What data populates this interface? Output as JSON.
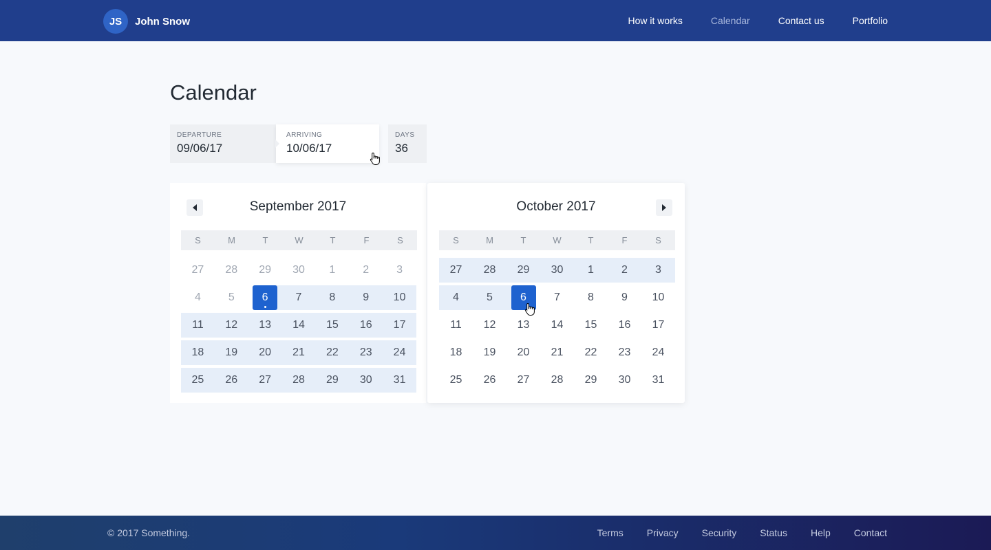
{
  "header": {
    "avatar_initials": "JS",
    "user_name": "John Snow",
    "nav": [
      {
        "label": "How it works",
        "active": false
      },
      {
        "label": "Calendar",
        "active": true
      },
      {
        "label": "Contact us",
        "active": false
      },
      {
        "label": "Portfolio",
        "active": false
      }
    ]
  },
  "page": {
    "title": "Calendar"
  },
  "fields": {
    "departure": {
      "label": "DEPARTURE",
      "value": "09/06/17"
    },
    "arriving": {
      "label": "ARRIVING",
      "value": "10/06/17"
    },
    "days": {
      "label": "DAYS",
      "value": "36"
    }
  },
  "calendars": [
    {
      "title": "September 2017",
      "weekdays": [
        "S",
        "M",
        "T",
        "W",
        "T",
        "F",
        "S"
      ],
      "weeks": [
        {
          "days": [
            "27",
            "28",
            "29",
            "30",
            "1",
            "2",
            "3"
          ],
          "muted": [
            true,
            true,
            true,
            true,
            true,
            true,
            true
          ],
          "band": null
        },
        {
          "days": [
            "4",
            "5",
            "6",
            "7",
            "8",
            "9",
            "10"
          ],
          "muted": [
            true,
            true,
            false,
            false,
            false,
            false,
            false
          ],
          "band": [
            2,
            6
          ],
          "selected": 2,
          "dot": 2
        },
        {
          "days": [
            "11",
            "12",
            "13",
            "14",
            "15",
            "16",
            "17"
          ],
          "muted": [
            false,
            false,
            false,
            false,
            false,
            false,
            false
          ],
          "band": [
            0,
            6
          ]
        },
        {
          "days": [
            "18",
            "19",
            "20",
            "21",
            "22",
            "23",
            "24"
          ],
          "muted": [
            false,
            false,
            false,
            false,
            false,
            false,
            false
          ],
          "band": [
            0,
            6
          ]
        },
        {
          "days": [
            "25",
            "26",
            "27",
            "28",
            "29",
            "30",
            "31"
          ],
          "muted": [
            false,
            false,
            false,
            false,
            false,
            false,
            false
          ],
          "band": [
            0,
            6
          ]
        }
      ]
    },
    {
      "title": "October 2017",
      "weekdays": [
        "S",
        "M",
        "T",
        "W",
        "T",
        "F",
        "S"
      ],
      "weeks": [
        {
          "days": [
            "27",
            "28",
            "29",
            "30",
            "1",
            "2",
            "3"
          ],
          "muted": [
            false,
            false,
            false,
            false,
            false,
            false,
            false
          ],
          "band": [
            0,
            6
          ]
        },
        {
          "days": [
            "4",
            "5",
            "6",
            "7",
            "8",
            "9",
            "10"
          ],
          "muted": [
            false,
            false,
            false,
            false,
            false,
            false,
            false
          ],
          "band": [
            0,
            2
          ],
          "selected": 2
        },
        {
          "days": [
            "11",
            "12",
            "13",
            "14",
            "15",
            "16",
            "17"
          ],
          "muted": [
            false,
            false,
            false,
            false,
            false,
            false,
            false
          ],
          "band": null
        },
        {
          "days": [
            "18",
            "19",
            "20",
            "21",
            "22",
            "23",
            "24"
          ],
          "muted": [
            false,
            false,
            false,
            false,
            false,
            false,
            false
          ],
          "band": null
        },
        {
          "days": [
            "25",
            "26",
            "27",
            "28",
            "29",
            "30",
            "31"
          ],
          "muted": [
            false,
            false,
            false,
            false,
            false,
            false,
            false
          ],
          "band": null
        }
      ]
    }
  ],
  "footer": {
    "copyright": "© 2017 Something.",
    "links": [
      "Terms",
      "Privacy",
      "Security",
      "Status",
      "Help",
      "Contact"
    ]
  },
  "colors": {
    "header_bg": "#203e8c",
    "accent": "#1e62cf",
    "range_band": "#e6eef9"
  },
  "icons": {
    "prev_month": "triangle-left-icon",
    "next_month": "triangle-right-icon"
  }
}
